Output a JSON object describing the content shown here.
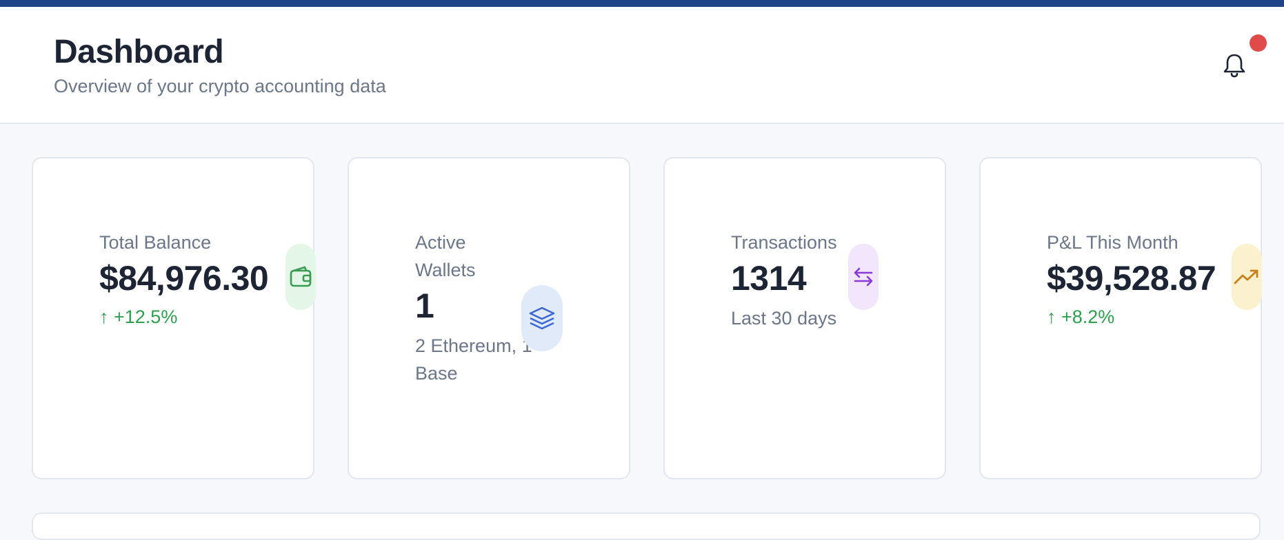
{
  "header": {
    "title": "Dashboard",
    "subtitle": "Overview of your crypto accounting data",
    "notification_icon": "bell-icon",
    "notification_badge_color": "#e04a4a"
  },
  "colors": {
    "top_bar": "#1f4387",
    "positive": "#2f9e4f",
    "muted_text": "#6b7689"
  },
  "stats": [
    {
      "label": "Total Balance",
      "value": "$84,976.30",
      "change": "↑ +12.5%",
      "icon": "wallet-icon",
      "icon_color": "#3a9a4f",
      "icon_bg": "#e3f6e7"
    },
    {
      "label": "Active Wallets",
      "value": "1",
      "detail": "2 Ethereum, 1 Base",
      "icon": "layers-icon",
      "icon_color": "#3b66d6",
      "icon_bg": "#e1eaf9"
    },
    {
      "label": "Transactions",
      "value": "1314",
      "detail": "Last 30 days",
      "icon": "arrows-exchange-icon",
      "icon_color": "#8a3ad6",
      "icon_bg": "#f1e6fb"
    },
    {
      "label": "P&L This Month",
      "value": "$39,528.87",
      "change": "↑ +8.2%",
      "icon": "trending-up-icon",
      "icon_color": "#c8801a",
      "icon_bg": "#fbf1cf"
    }
  ]
}
